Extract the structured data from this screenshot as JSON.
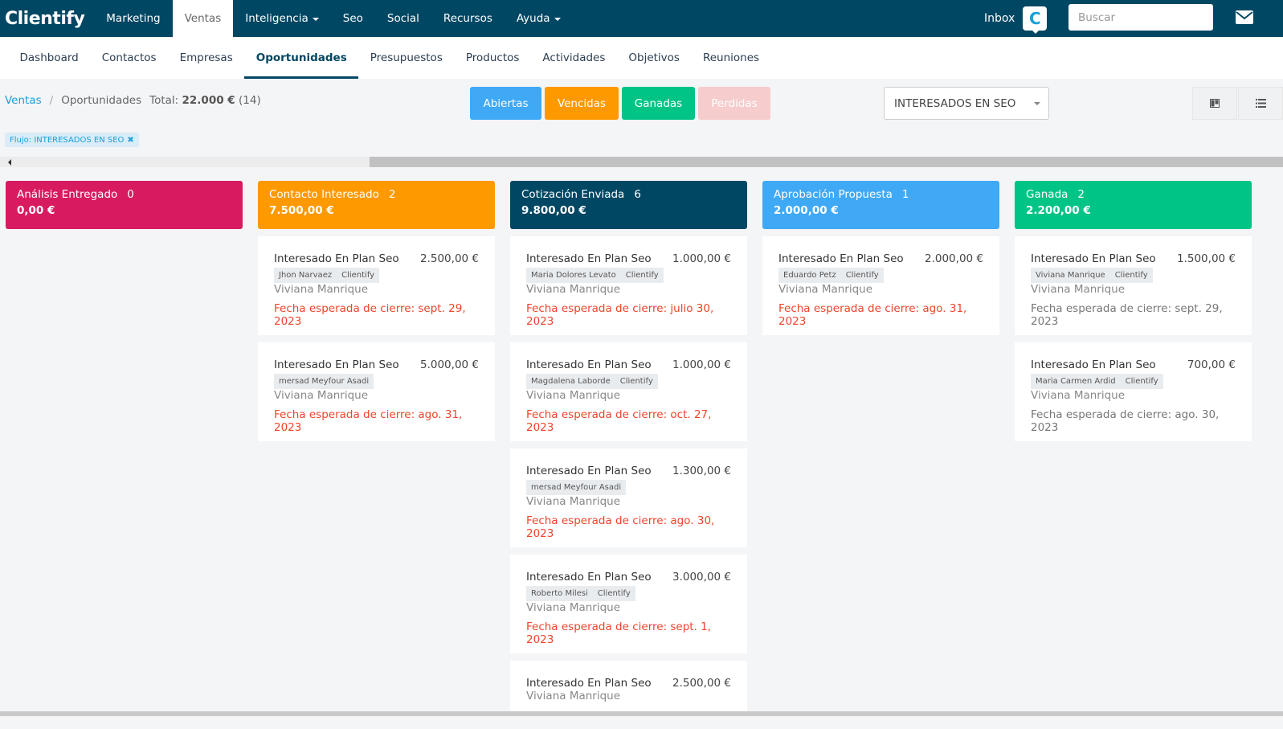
{
  "topbar": {
    "logo": "Clientify",
    "nav": [
      {
        "label": "Marketing",
        "active": false,
        "caret": false
      },
      {
        "label": "Ventas",
        "active": true,
        "caret": false
      },
      {
        "label": "Inteligencia",
        "active": false,
        "caret": true
      },
      {
        "label": "Seo",
        "active": false,
        "caret": false
      },
      {
        "label": "Social",
        "active": false,
        "caret": false
      },
      {
        "label": "Recursos",
        "active": false,
        "caret": false
      },
      {
        "label": "Ayuda",
        "active": false,
        "caret": true
      }
    ],
    "inbox_label": "Inbox",
    "inbox_badge": "C",
    "search_placeholder": "Buscar",
    "mail_icon": "envelope-icon"
  },
  "subnav": [
    {
      "label": "Dashboard",
      "active": false
    },
    {
      "label": "Contactos",
      "active": false
    },
    {
      "label": "Empresas",
      "active": false
    },
    {
      "label": "Oportunidades",
      "active": true
    },
    {
      "label": "Presupuestos",
      "active": false
    },
    {
      "label": "Productos",
      "active": false
    },
    {
      "label": "Actividades",
      "active": false
    },
    {
      "label": "Objetivos",
      "active": false
    },
    {
      "label": "Reuniones",
      "active": false
    }
  ],
  "breadcrumb": {
    "root": "Ventas",
    "sep": "/",
    "current": "Oportunidades",
    "total_label": "Total:",
    "total_value": "22.000 €",
    "total_count": "(14)"
  },
  "status_buttons": [
    {
      "label": "Abiertas",
      "color": "#3fa9f5"
    },
    {
      "label": "Vencidas",
      "color": "#ff9900"
    },
    {
      "label": "Ganadas",
      "color": "#00c486"
    },
    {
      "label": "Perdidas",
      "color": "#f6cccc"
    }
  ],
  "flow_select": {
    "value": "INTERESADOS EN SEO"
  },
  "filter_tag": {
    "label": "Flujo: INTERESADOS EN SEO",
    "remove": "✖"
  },
  "columns": [
    {
      "name": "Análisis Entregado",
      "count": "0",
      "amount": "0,00 €",
      "color": "#d81b60",
      "cards": []
    },
    {
      "name": "Contacto Interesado",
      "count": "2",
      "amount": "7.500,00 €",
      "color": "#ff9900",
      "cards": [
        {
          "title": "Interesado En Plan Seo",
          "amount": "2.500,00 €",
          "tags": [
            "Jhon Narvaez",
            "Clientify"
          ],
          "owner": "Viviana Manrique",
          "date": "Fecha esperada de cierre: sept. 29, 2023",
          "overdue": true
        },
        {
          "title": "Interesado En Plan Seo",
          "amount": "5.000,00 €",
          "tags": [
            "mersad Meyfour Asadi"
          ],
          "owner": "Viviana Manrique",
          "date": "Fecha esperada de cierre: ago. 31, 2023",
          "overdue": true
        }
      ]
    },
    {
      "name": "Cotización Enviada",
      "count": "6",
      "amount": "9.800,00 €",
      "color": "#004763",
      "cards": [
        {
          "title": "Interesado En Plan Seo",
          "amount": "1.000,00 €",
          "tags": [
            "Maria Dolores Levato",
            "Clientify"
          ],
          "owner": "Viviana Manrique",
          "date": "Fecha esperada de cierre: julio 30, 2023",
          "overdue": true
        },
        {
          "title": "Interesado En Plan Seo",
          "amount": "1.000,00 €",
          "tags": [
            "Magdalena Laborde",
            "Clientify"
          ],
          "owner": "Viviana Manrique",
          "date": "Fecha esperada de cierre: oct. 27, 2023",
          "overdue": true
        },
        {
          "title": "Interesado En Plan Seo",
          "amount": "1.300,00 €",
          "tags": [
            "mersad Meyfour Asadi"
          ],
          "owner": "Viviana Manrique",
          "date": "Fecha esperada de cierre: ago. 30, 2023",
          "overdue": true
        },
        {
          "title": "Interesado En Plan Seo",
          "amount": "3.000,00 €",
          "tags": [
            "Roberto Milesi",
            "Clientify"
          ],
          "owner": "Viviana Manrique",
          "date": "Fecha esperada de cierre: sept. 1, 2023",
          "overdue": true
        },
        {
          "title": "Interesado En Plan Seo",
          "amount": "2.500,00 €",
          "tags": [],
          "owner": "Viviana Manrique",
          "date": "",
          "overdue": true
        }
      ]
    },
    {
      "name": "Aprobación Propuesta",
      "count": "1",
      "amount": "2.000,00 €",
      "color": "#3fa9f5",
      "cards": [
        {
          "title": "Interesado En Plan Seo",
          "amount": "2.000,00 €",
          "tags": [
            "Eduardo Petz",
            "Clientify"
          ],
          "owner": "Viviana Manrique",
          "date": "Fecha esperada de cierre: ago. 31, 2023",
          "overdue": true
        }
      ]
    },
    {
      "name": "Ganada",
      "count": "2",
      "amount": "2.200,00 €",
      "color": "#00c486",
      "cards": [
        {
          "title": "Interesado En Plan Seo",
          "amount": "1.500,00 €",
          "tags": [
            "Viviana Manrique",
            "Clientify"
          ],
          "owner": "Viviana Manrique",
          "date": "Fecha esperada de cierre: sept. 29, 2023",
          "overdue": false
        },
        {
          "title": "Interesado En Plan Seo",
          "amount": "700,00 €",
          "tags": [
            "Maria Carmen Ardid",
            "Clientify"
          ],
          "owner": "Viviana Manrique",
          "date": "Fecha esperada de cierre: ago. 30, 2023",
          "overdue": false
        }
      ]
    }
  ]
}
